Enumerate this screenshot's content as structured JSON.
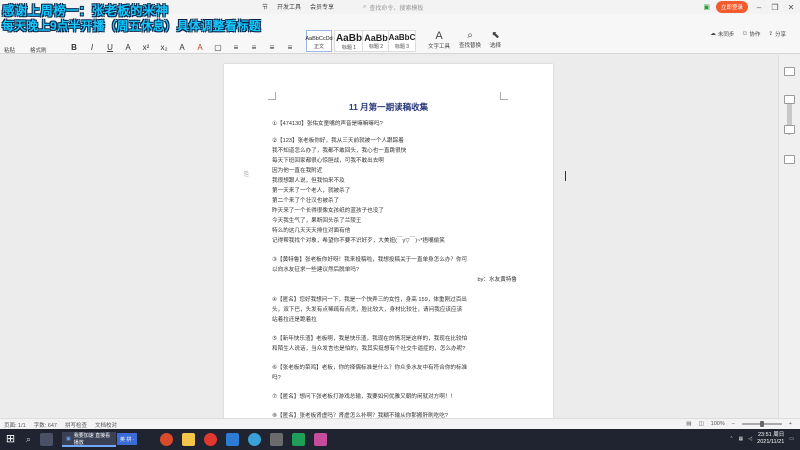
{
  "overlay": {
    "line1": "感谢上周榜一：张老板的米神",
    "line2": "每天晚上9点半开播（周五休息）具体调整看标题"
  },
  "titlebar": {
    "menus": [
      "节",
      "开发工具",
      "会员专享"
    ],
    "search_placeholder": "查找命令、搜索模板",
    "login_label": "立即登录"
  },
  "ribbon": {
    "paste_label": "粘贴",
    "format_painter_label": "格式刷",
    "styles": [
      {
        "sample": "AaBbCcDd",
        "name": "正文"
      },
      {
        "sample": "AaBb",
        "name": "标题 1"
      },
      {
        "sample": "AaBb",
        "name": "标题 2"
      },
      {
        "sample": "AaBbC",
        "name": "标题 3"
      }
    ],
    "text_tools_label": "文字工具",
    "find_replace_label": "查找替换",
    "select_label": "选择",
    "unsaved_label": "未同步",
    "collab_label": "协作",
    "share_label": "分享"
  },
  "document": {
    "title": "11 月第一期读稿收集",
    "lines": [
      "①【474130】张佑女童嘴的声音是嘛嘛嘛吗?",
      "",
      "②【123】张老板你好，我从三天前就被一个人跟踪着",
      "我不知道怎么办了，我都不敢回头，我心也一直跳很快",
      "每天下班回家都很心惊胆战，可我不敢出去啊",
      "因为他一直在我附近",
      "我很想跟人说，但我怕来不及",
      "第一天来了一个老人，就被杀了",
      "第二个来了个壮汉也被杀了",
      "昨天来了一个长得很像女孩纸的蓝孩子也没了",
      "今天我生气了，果断回头杀了兰陵王",
      "特么的这几天天天排位对面有他",
      "记得帮我找个对象，希望你不要不识好歹，大美妞(￣y▽￣)~*捂嘴偷笑",
      "",
      "③【黄特鲁】张老板你好呀！我来投稿啦，我想投稿关于一直单身怎么办？你可",
      "以向水友征求一些建议然后脱单吗?",
      "by：水友黄特鲁",
      "",
      "④【匿名】您好我想问一下，我是一个快弄三的女性，身高 159，体重刚过百出",
      "头，双下巴，头发有点稀疏有点秃，脸比较大，身材比较壮，请问我应该应该",
      "站着拉还是跪着拉",
      "",
      "⑤【新年快乐渣】老板啊，我是快乐渣，我现在的情况是这样的，我现在比较怕",
      "和陌生人说话，当众发言也是怕的，我其实挺想有个社交牛逼症的，怎么办呢?",
      "",
      "⑥【张老板的菜鸡】老板，你的择偶标准是什么？你众多水友中有符合你的标准",
      "吗?",
      "",
      "⑦【匿名】想问下张老板打游戏总输，我要如何优雅又朝的闲就对方啊！！",
      "",
      "⑧【匿名】张老板肾虚吗？肾虚怎么补啊？我糊不输从你那搬肝刷吃吃?"
    ]
  },
  "statusbar": {
    "page": "页面: 1/1",
    "words": "字数: 647",
    "spellcheck": "拼写检查",
    "doc_check": "文档校对",
    "zoom": "100%"
  },
  "taskbar": {
    "task_label": "我要加速 直接看播放",
    "ime_label": "英 拼 ·",
    "time": "23:51 周日",
    "date": "2021/11/21"
  },
  "colors": {
    "overlay_text": "#18c9ff",
    "accent": "#f25b2d",
    "doc_title": "#2a3a7a"
  }
}
